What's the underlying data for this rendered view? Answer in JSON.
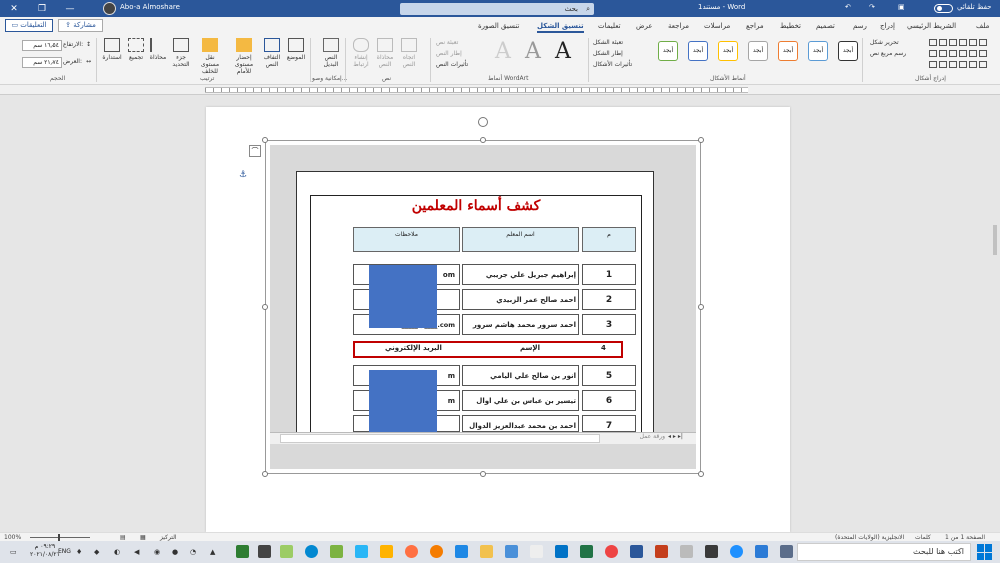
{
  "window": {
    "autosave_label": "حفظ تلقائي",
    "doc_title": "مستند1 - Word",
    "search_placeholder": "بحث",
    "user_name": "Abo-a Almoshare",
    "minimize": "—",
    "restore": "❐",
    "close": "✕"
  },
  "tabs": {
    "file": "ملف",
    "home": "الشريط الرئيسي",
    "insert": "إدراج",
    "draw": "رسم",
    "design": "تصميم",
    "layout": "تخطيط",
    "references": "مراجع",
    "mailings": "مراسلات",
    "review": "مراجعة",
    "view": "عرض",
    "help": "تعليمات",
    "shape_format": "تنسيق الشكل",
    "picture_format": "تنسيق الصورة",
    "share": "مشاركة",
    "comments": "التعليقات"
  },
  "ribbon": {
    "insert_shapes": {
      "label": "إدراج أشكال",
      "edit_shape": "تحرير شكل",
      "text_box": "رسم مربع نص"
    },
    "shape_styles": {
      "label": "أنماط الأشكال",
      "preset": "أبجد",
      "fill": "تعبئة الشكل",
      "outline": "إطار الشكل",
      "effects": "تأثيرات الأشكال"
    },
    "wordart": {
      "label": "أنماط WordArt",
      "letter": "A",
      "text_fill": "تعبئة نص",
      "text_outline": "إطار النص",
      "text_effects": "تأثيرات النص"
    },
    "text": {
      "label": "نص",
      "direction": "اتجاه النص",
      "align": "محاذاة النص",
      "link": "إنشاء ارتباط"
    },
    "accessibility": {
      "label": "إمكانية وصو...",
      "alt_text": "النص البديل"
    },
    "arrange": {
      "label": "ترتيب",
      "position": "الموضع",
      "wrap": "التفاف النص",
      "forward": "إحضار مستوى للأمام",
      "backward": "نقل مستوى للخلف",
      "selection_pane": "جزء التحديد",
      "align": "محاذاة",
      "group": "تجميع",
      "rotate": "استدارة"
    },
    "size": {
      "label": "الحجم",
      "height_label": "الارتفاع:",
      "height_value": "١٦٫٥٤ سم",
      "width_label": "العرض:",
      "width_value": "٢١٫٧٤ سم"
    }
  },
  "sheet": {
    "title": "كشف أسماء المعلمين",
    "headers": {
      "num": "م",
      "name": "اسم المعلم",
      "notes": "ملاحظات"
    },
    "rows": [
      {
        "num": "1",
        "name": "إبراهيم جبريل علي جريبي",
        "note": "om"
      },
      {
        "num": "2",
        "name": "احمد صالح عمر الزبيدي",
        "note": ""
      },
      {
        "num": "3",
        "name": "احمد سرور محمد هاشم سرور",
        "note": "abo_____@____.com"
      },
      {
        "num": "5",
        "name": "انور بن صالح علي اليامي",
        "note": "m"
      },
      {
        "num": "6",
        "name": "تيسير بن عباس بن علي اوال",
        "note": "m"
      },
      {
        "num": "7",
        "name": "احمد بن محمد عبدالعزيز الدوال",
        "note": ""
      }
    ],
    "highlight_row": {
      "num": "4",
      "name": "الإسم",
      "email": "البريد الإلكتروني"
    },
    "sheet_tab": "ورقة عمل",
    "nav": "◂ ▸ ▸|"
  },
  "statusbar": {
    "page": "الصفحة 1 من 1",
    "words": "كلمات",
    "language": "الانجليزية (الولايات المتحدة)",
    "focus": "التركيز",
    "zoom": "100%"
  },
  "taskbar": {
    "search": "اكتب هنا للبحث",
    "time": "٠٩:٢٩ م",
    "date": "٢٠٢١/٠٨/٢١",
    "lang": "ENG"
  },
  "colors": {
    "word_blue": "#2b579a",
    "title_red": "#c00000",
    "header_fill": "#dceef5",
    "redaction": "#4472c4"
  }
}
